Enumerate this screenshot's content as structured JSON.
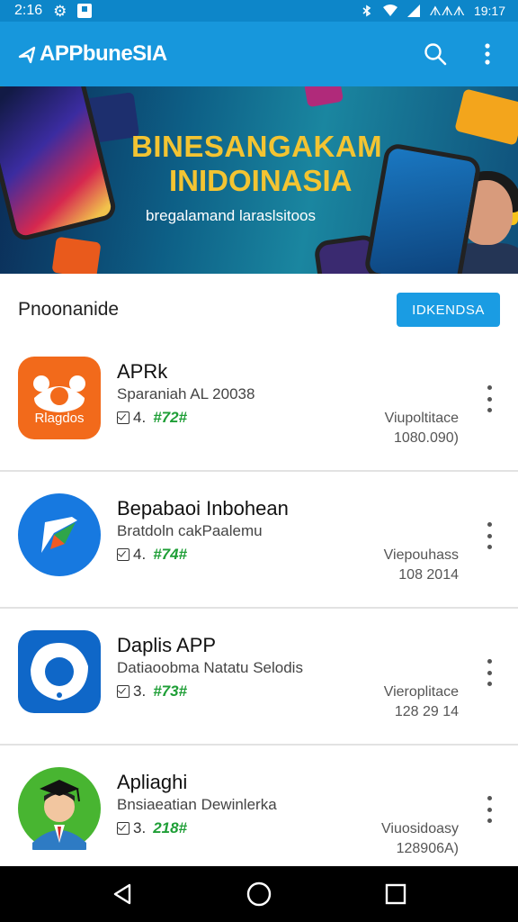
{
  "status_bar": {
    "time_left": "2:16",
    "right_text": "⛉  ▼  ᗑᗑᗑ 19:17"
  },
  "app_bar": {
    "title": "APPbuneSIA"
  },
  "banner": {
    "title_line1": "BINESANGAKAM",
    "title_line2": "INIDOINASIA",
    "subtitle": "bregalamand laraslsitoos"
  },
  "section": {
    "title": "Pnoonanide",
    "button_label": "IDKENDSA"
  },
  "apps": [
    {
      "name": "APRk",
      "subtitle": "Sparaniah AL 20038",
      "rating": "4.",
      "code": "#72#",
      "meta_line1": "Viupoltitace",
      "meta_line2": "1080.090)",
      "icon_label": "Rlagdos"
    },
    {
      "name": "Bepabaoi Inbohean",
      "subtitle": "Bratdoln cakPaalemu",
      "rating": "4.",
      "code": "#74#",
      "meta_line1": "Viepouhass",
      "meta_line2": "108 2014"
    },
    {
      "name": "Daplis APP",
      "subtitle": "Datiaoobma Natatu Selodis",
      "rating": "3.",
      "code": "#73#",
      "meta_line1": "Vieroplitace",
      "meta_line2": "128 29 14"
    },
    {
      "name": "Apliaghi",
      "subtitle": "Bnsiaeatian Dewinlerka",
      "rating": "3.",
      "code": "218#",
      "meta_line1": "Viuosidoasy",
      "meta_line2": "128906A)"
    }
  ],
  "colors": {
    "primary": "#1797dc",
    "status": "#0d86c9",
    "rating_green": "#1e9e36",
    "banner_gold": "#f3c432"
  }
}
